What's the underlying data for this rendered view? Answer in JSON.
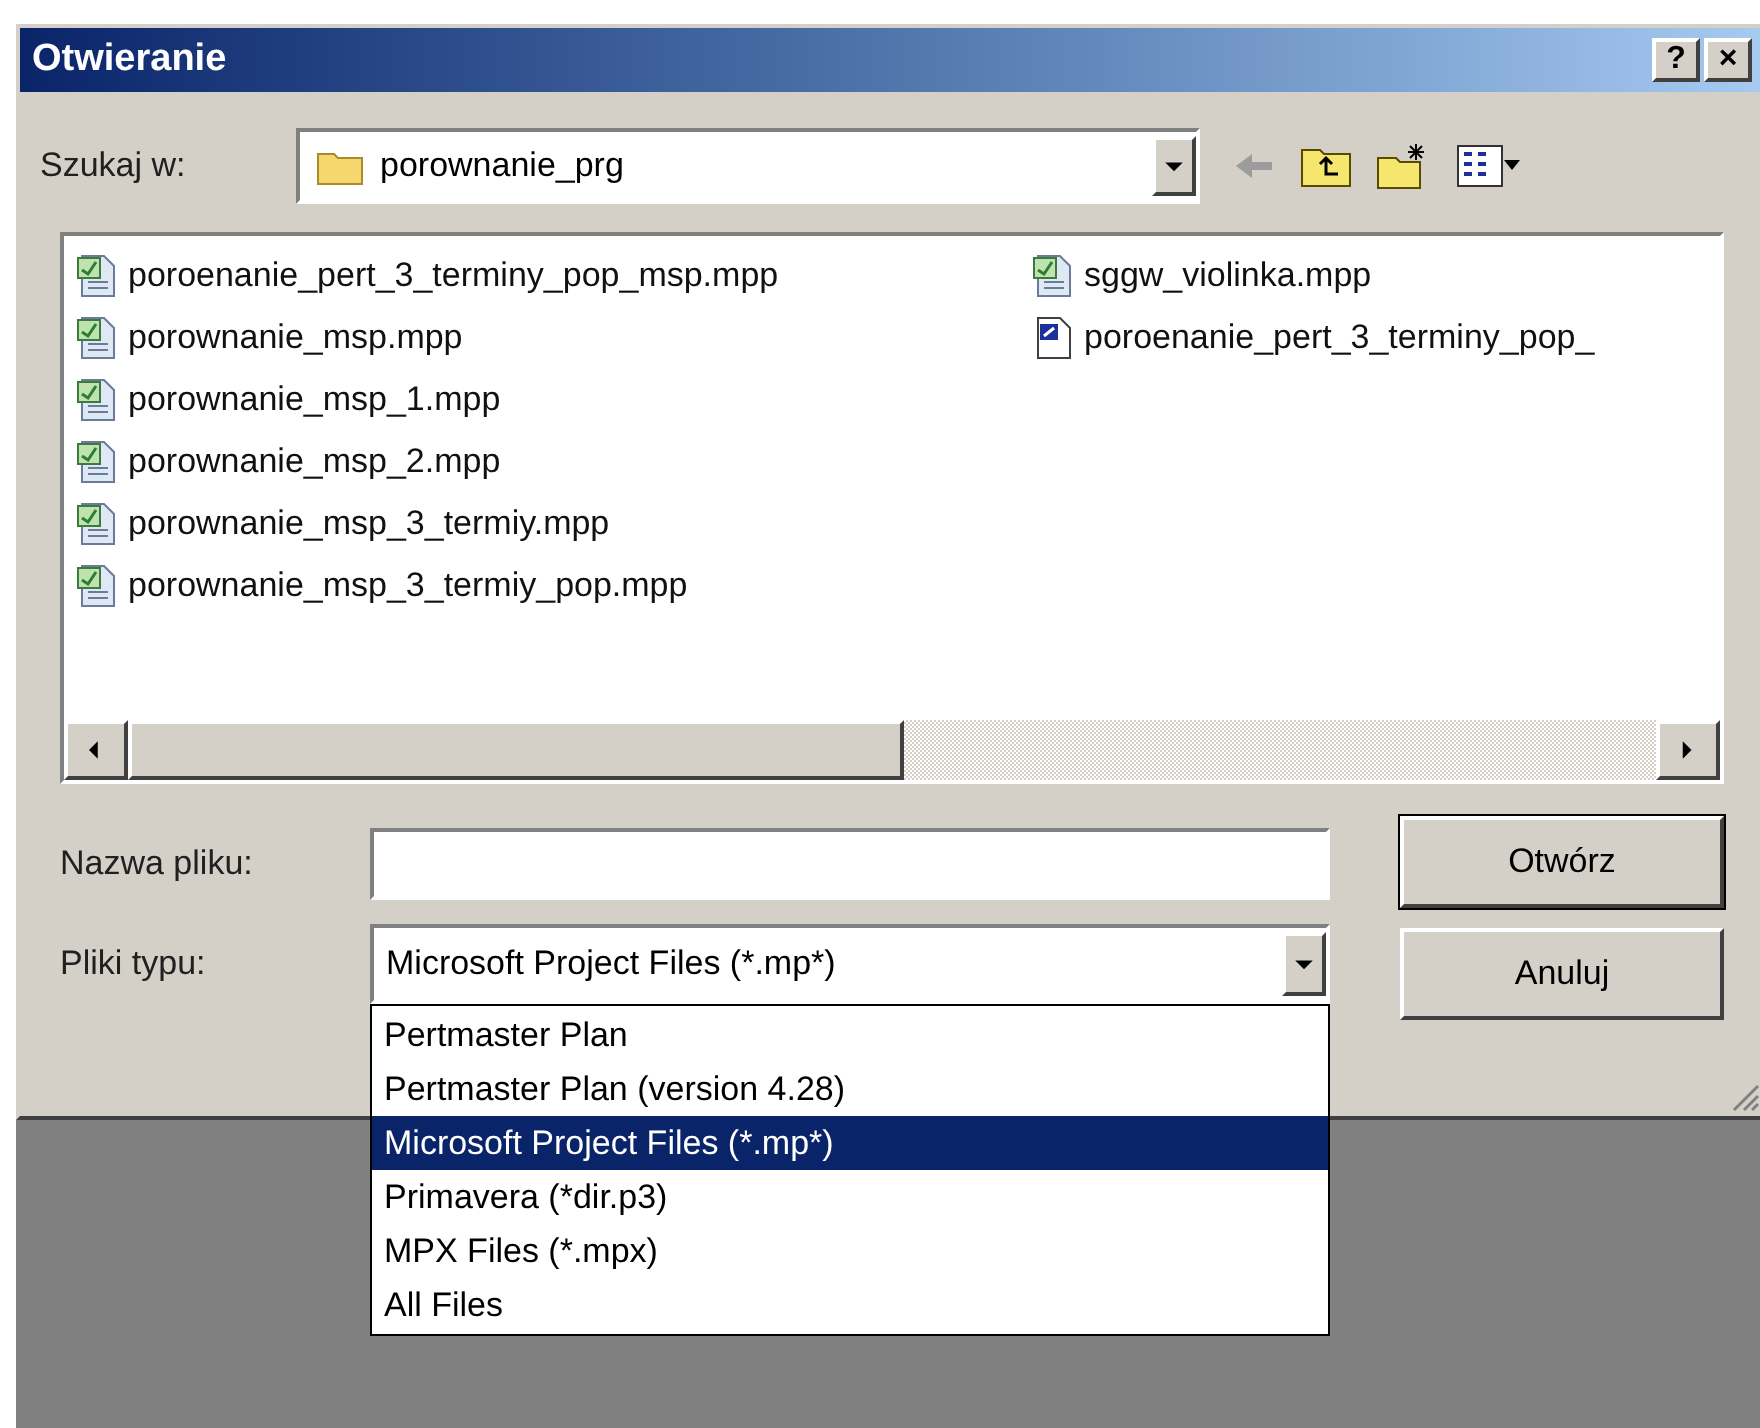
{
  "window": {
    "title": "Otwieranie",
    "buttons": [
      "?",
      "×"
    ]
  },
  "look_in": {
    "label": "Szukaj w:",
    "value": "porownanie_prg"
  },
  "files": [
    {
      "name": "poroenanie_pert_3_terminy_pop_msp.mpp",
      "kind": "project"
    },
    {
      "name": "porownanie_msp.mpp",
      "kind": "project"
    },
    {
      "name": "porownanie_msp_1.mpp",
      "kind": "project"
    },
    {
      "name": "porownanie_msp_2.mpp",
      "kind": "project"
    },
    {
      "name": "porownanie_msp_3_termiy.mpp",
      "kind": "project"
    },
    {
      "name": "porownanie_msp_3_termiy_pop.mpp",
      "kind": "project"
    },
    {
      "name": "sggw_violinka.mpp",
      "kind": "project"
    },
    {
      "name": "poroenanie_pert_3_terminy_pop_",
      "kind": "exchange"
    }
  ],
  "file_name": {
    "label": "Nazwa pliku:"
  },
  "file_type": {
    "label": "Pliki typu:",
    "value": "Microsoft Project Files (*.mp*)",
    "expanded": true,
    "options": [
      {
        "label": "Pertmaster Plan",
        "selected": false
      },
      {
        "label": "Pertmaster Plan (version 4.28)",
        "selected": false
      },
      {
        "label": "Microsoft Project Files (*.mp*)",
        "selected": true
      },
      {
        "label": "Primavera (*dir.p3)",
        "selected": false
      },
      {
        "label": "MPX Files (*.mpx)",
        "selected": false
      },
      {
        "label": "All Files",
        "selected": false
      }
    ]
  },
  "buttons": [
    {
      "label": "Otwórz",
      "default": true
    },
    {
      "label": "Anuluj",
      "default": false
    }
  ]
}
